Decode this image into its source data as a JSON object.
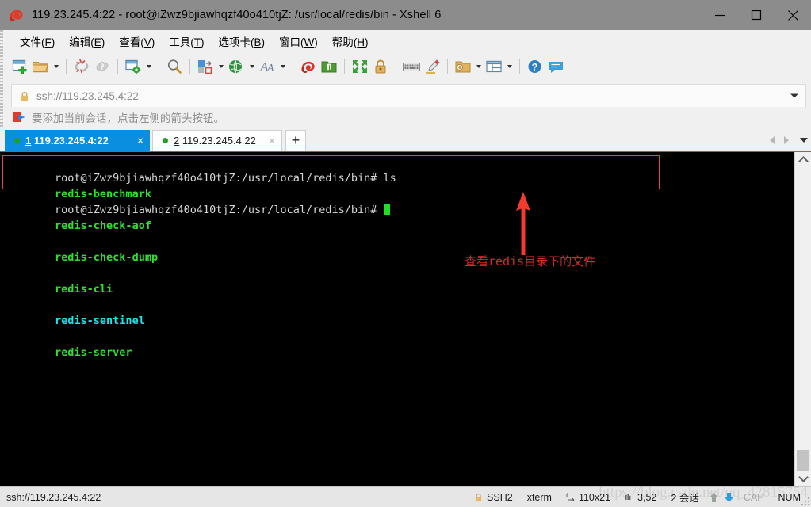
{
  "window": {
    "title": "119.23.245.4:22 - root@iZwz9bjiawhqzf40o410tjZ: /usr/local/redis/bin - Xshell 6",
    "app_icon": "xshell-logo-icon",
    "minimize_label": "—",
    "maximize_label": "□",
    "close_label": "×"
  },
  "menu": {
    "items": [
      {
        "label": "文件",
        "accel": "F"
      },
      {
        "label": "编辑",
        "accel": "E"
      },
      {
        "label": "查看",
        "accel": "V"
      },
      {
        "label": "工具",
        "accel": "T"
      },
      {
        "label": "选项卡",
        "accel": "B"
      },
      {
        "label": "窗口",
        "accel": "W"
      },
      {
        "label": "帮助",
        "accel": "H"
      }
    ]
  },
  "toolbar": {
    "buttons": [
      "new-session-icon",
      "open-folder-icon",
      "disconnect-icon",
      "connect-icon",
      "session-properties-icon",
      "find-icon",
      "file-transfer-icon",
      "web-browser-icon",
      "font-icon",
      "spiral-icon",
      "green-folder-icon",
      "fullscreen-icon",
      "lock-icon",
      "keyboard-icon",
      "highlighter-icon",
      "add-folder-icon",
      "layout-icon",
      "help-icon",
      "chat-icon"
    ]
  },
  "address": {
    "value": "ssh://119.23.245.4:22",
    "lock_icon": "padlock-icon",
    "dropdown_icon": "chevron-down-icon"
  },
  "hint": {
    "icon": "add-to-favorites-arrow-icon",
    "text": "要添加当前会话，点击左侧的箭头按钮。"
  },
  "tabs": {
    "items": [
      {
        "index": "1",
        "title": "119.23.245.4:22",
        "active": true,
        "close_label": "×",
        "status": "connected"
      },
      {
        "index": "2",
        "title": "119.23.245.4:22",
        "active": false,
        "close_label": "×",
        "status": "connected"
      }
    ],
    "new_tab_label": "+",
    "nav_prev_icon": "chevron-left-icon",
    "nav_next_icon": "chevron-right-icon",
    "nav_list_icon": "chevron-down-icon"
  },
  "terminal": {
    "colors": {
      "background": "#000000",
      "foreground": "#d8d8d8",
      "green": "#2ee02e",
      "cyan": "#22dfe8",
      "cursor": "#20e020",
      "highlight_box": "#e04646"
    },
    "lines": [
      {
        "segments": [
          {
            "text": "root@iZwz9bjiawhqzf40o410tjZ:/usr/local/redis/bin# ls",
            "color": "white"
          }
        ]
      },
      {
        "segments": [
          {
            "text": "redis-benchmark",
            "color": "green"
          },
          {
            "text": "  ",
            "color": "white"
          },
          {
            "text": "redis-check-aof",
            "color": "green"
          },
          {
            "text": "  ",
            "color": "white"
          },
          {
            "text": "redis-check-dump",
            "color": "green"
          },
          {
            "text": "  ",
            "color": "white"
          },
          {
            "text": "redis-cli",
            "color": "green"
          },
          {
            "text": "  ",
            "color": "white"
          },
          {
            "text": "redis-sentinel",
            "color": "cyan"
          },
          {
            "text": "  ",
            "color": "white"
          },
          {
            "text": "redis-server",
            "color": "green"
          }
        ]
      },
      {
        "segments": [
          {
            "text": "root@iZwz9bjiawhqzf40o410tjZ:/usr/local/redis/bin# ",
            "color": "white"
          }
        ]
      }
    ]
  },
  "annotation": {
    "arrow_icon": "red-up-arrow-annotation",
    "text": "查看redis目录下的文件",
    "color": "#d42a2a"
  },
  "scrollbar": {
    "up_icon": "chevron-up-icon",
    "down_icon": "chevron-down-icon"
  },
  "statusbar": {
    "connection": "ssh://119.23.245.4:22",
    "lock_icon": "padlock-icon",
    "protocol": "SSH2",
    "terminal_type": "xterm",
    "size_icon": "terminal-size-icon",
    "size": "110x21",
    "cursor_icon": "cursor-position-icon",
    "cursor_position": "3,52",
    "sessions": "2 会话",
    "transfer_up_icon": "arrow-up-icon",
    "transfer_down_icon": "arrow-down-icon",
    "caps_lock": "CAP",
    "num_lock": "NUM",
    "watermark": "https://blog.csdn.net/qq_42815754"
  }
}
